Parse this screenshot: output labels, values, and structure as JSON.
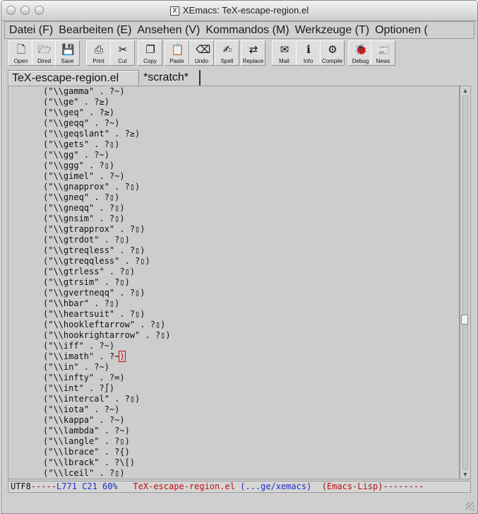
{
  "window": {
    "title": "XEmacs: TeX-escape-region.el",
    "app_icon": "X"
  },
  "menubar": [
    {
      "label": "Datei (F)"
    },
    {
      "label": "Bearbeiten (E)"
    },
    {
      "label": "Ansehen (V)"
    },
    {
      "label": "Kommandos (M)"
    },
    {
      "label": "Werkzeuge (T)"
    },
    {
      "label": "Optionen ("
    }
  ],
  "toolbar": [
    {
      "label": "Open",
      "icon": "open-icon",
      "glyph": "🗋"
    },
    {
      "label": "Dired",
      "icon": "dired-icon",
      "glyph": "🗁"
    },
    {
      "label": "Save",
      "icon": "save-icon",
      "glyph": "💾"
    },
    {
      "label": "Print",
      "icon": "print-icon",
      "glyph": "⎙"
    },
    {
      "label": "Cut",
      "icon": "cut-icon",
      "glyph": "✂"
    },
    {
      "label": "Copy",
      "icon": "copy-icon",
      "glyph": "❐"
    },
    {
      "label": "Paste",
      "icon": "paste-icon",
      "glyph": "📋"
    },
    {
      "label": "Undo",
      "icon": "undo-icon",
      "glyph": "⌫"
    },
    {
      "label": "Spell",
      "icon": "spell-icon",
      "glyph": "✍"
    },
    {
      "label": "Replace",
      "icon": "replace-icon",
      "glyph": "⇄"
    },
    {
      "label": "Mail",
      "icon": "mail-icon",
      "glyph": "✉"
    },
    {
      "label": "Info",
      "icon": "info-icon",
      "glyph": "ℹ"
    },
    {
      "label": "Compile",
      "icon": "compile-icon",
      "glyph": "⚙"
    },
    {
      "label": "Debug",
      "icon": "debug-icon",
      "glyph": "🐞"
    },
    {
      "label": "News",
      "icon": "news-icon",
      "glyph": "📰"
    }
  ],
  "tabs": [
    {
      "label": "TeX-escape-region.el",
      "active": true
    },
    {
      "label": "*scratch*",
      "active": false
    }
  ],
  "buffer": {
    "lines": [
      "(\"\\\\gamma\" . ?~)",
      "(\"\\\\ge\" . ?≥)",
      "(\"\\\\geq\" . ?≥)",
      "(\"\\\\geqq\" . ?~)",
      "(\"\\\\geqslant\" . ?≥)",
      "(\"\\\\gets\" . ?▯)",
      "(\"\\\\gg\" . ?~)",
      "(\"\\\\ggg\" . ?▯)",
      "(\"\\\\gimel\" . ?~)",
      "(\"\\\\gnapprox\" . ?▯)",
      "(\"\\\\gneq\" . ?▯)",
      "(\"\\\\gneqq\" . ?▯)",
      "(\"\\\\gnsim\" . ?▯)",
      "(\"\\\\gtrapprox\" . ?▯)",
      "(\"\\\\gtrdot\" . ?▯)",
      "(\"\\\\gtreqless\" . ?▯)",
      "(\"\\\\gtreqqless\" . ?▯)",
      "(\"\\\\gtrless\" . ?▯)",
      "(\"\\\\gtrsim\" . ?▯)",
      "(\"\\\\gvertneqq\" . ?▯)",
      "(\"\\\\hbar\" . ?▯)",
      "(\"\\\\heartsuit\" . ?▯)",
      "(\"\\\\hookleftarrow\" . ?▯)",
      "(\"\\\\hookrightarrow\" . ?▯)",
      "(\"\\\\iff\" . ?~)",
      "(\"\\\\imath\" . ?~",
      "(\"\\\\in\" . ?~)",
      "(\"\\\\infty\" . ?∞)",
      "(\"\\\\int\" . ?∫)",
      "(\"\\\\intercal\" . ?▯)",
      "(\"\\\\iota\" . ?~)",
      "(\"\\\\kappa\" . ?~)",
      "(\"\\\\lambda\" . ?~)",
      "(\"\\\\langle\" . ?▯)",
      "(\"\\\\lbrace\" . ?{)",
      "(\"\\\\lbrack\" . ?\\[)",
      "(\"\\\\lceil\" . ?▯)"
    ],
    "cursor_char": ")"
  },
  "scrollbar": {
    "position_fraction": 0.6
  },
  "modeline": {
    "coding": "UTF8",
    "dashes1": "-----",
    "position": "L771 C21 60%",
    "buffer_name": "TeX-escape-region.el",
    "directory": "(...ge/xemacs)",
    "mode_open": "(",
    "mode": "Emacs-Lisp",
    "mode_close": ")",
    "dashes2": "--------"
  }
}
